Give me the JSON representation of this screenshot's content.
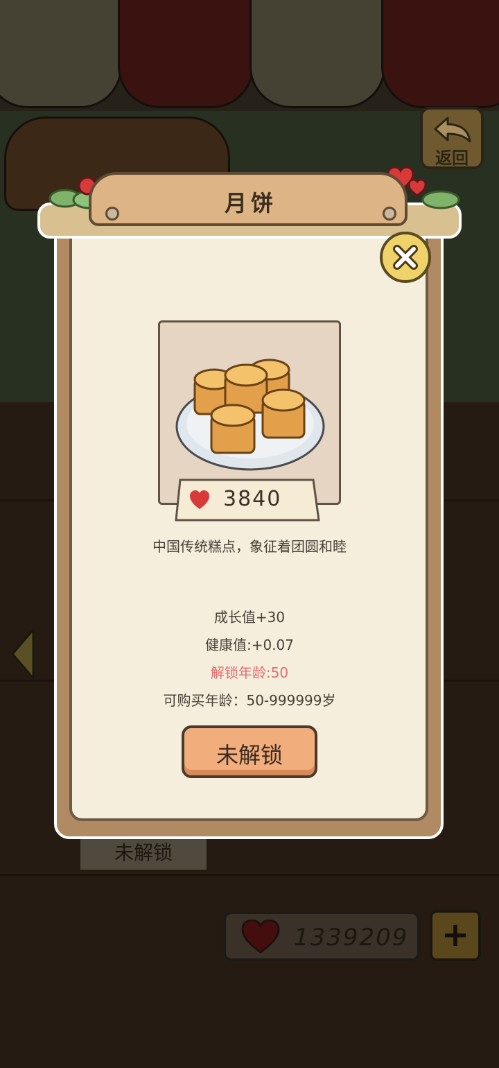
{
  "header": {
    "back_label": "返回"
  },
  "modal": {
    "title": "月饼",
    "item": {
      "name": "月饼",
      "price": "3840",
      "description": "中国传统糕点，象征着团圆和睦",
      "growth": "成长值+30",
      "health": "健康值:+0.07",
      "unlock_age": "解锁年龄:50",
      "buy_age": "可购买年龄：50-999999岁"
    },
    "unlock_button_label": "未解锁"
  },
  "background": {
    "behind_label": "未解锁"
  },
  "footer": {
    "hearts_total": "1339209"
  },
  "icons": [
    "back-arrow-icon",
    "close-icon",
    "heart-icon",
    "plus-icon",
    "left-arrow-icon",
    "mooncake-plate-image"
  ],
  "colors": {
    "accent": "#f2ad7d",
    "unlock_age_text": "#e56a6a",
    "card_bg": "#f5eedd",
    "heart": "#d83a3a"
  }
}
